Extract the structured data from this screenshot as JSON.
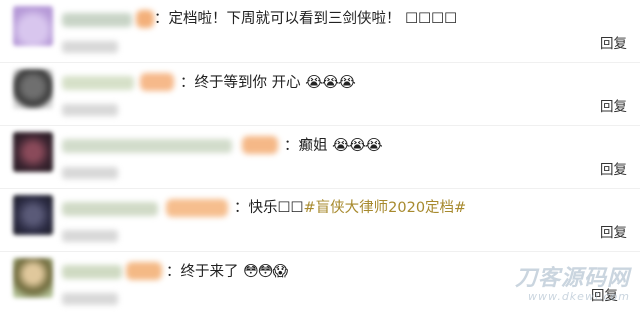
{
  "comments": [
    {
      "text": "：定档啦！下周就可以看到三剑侠啦！ ☐☐☐☐",
      "tag": "",
      "emojis": "",
      "reply_label": "回复"
    },
    {
      "text": "：终于等到你 开心",
      "tag": "",
      "emojis": "😭😭😭",
      "reply_label": "回复"
    },
    {
      "text": "：癫姐",
      "tag": "",
      "emojis": "😭😭😭",
      "reply_label": "回复"
    },
    {
      "text": "：快乐☐☐",
      "tag": "#盲侠大律师2020定档#",
      "emojis": "",
      "reply_label": "回复"
    },
    {
      "text": "：终于来了",
      "tag": "",
      "emojis": "😳😳😱",
      "reply_label": "回复"
    }
  ],
  "watermark": {
    "title": "刀客源码网",
    "url": "www.dkewl.com"
  }
}
